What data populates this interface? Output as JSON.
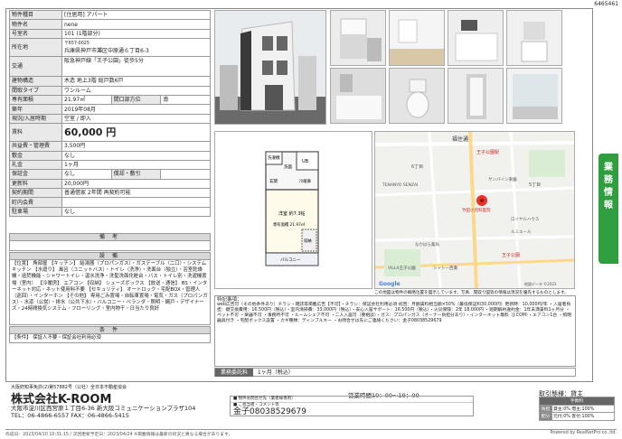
{
  "page_id": "6465461",
  "property": {
    "type_label": "物件種目",
    "type_value": "[住居用] アパート",
    "name_label": "物件名",
    "name_value": "nene",
    "room_label": "号室名",
    "room_value": "101 (1階部分)",
    "address_label": "所在地",
    "postcode": "〒657-0025",
    "address_value": "兵庫県神戸市灘区中原通６丁目6-3",
    "traffic_label": "交通",
    "traffic_value": "阪急神戸線「王子公園」徒歩5分",
    "structure_label": "建物構造",
    "structure_value": "木造 地上3階 総戸数6戸",
    "layout_label": "間取タイプ",
    "layout_value": "ワンルーム",
    "area_label": "専有面積",
    "area_value": "21.97㎡",
    "direction_label": "間口部方位",
    "direction_value": "南",
    "built_label": "築年",
    "built_value": "2019年08月",
    "status_label": "現況/入居時期",
    "status_value": "空室 / 即入",
    "rent_label": "賃料",
    "rent_value": "60,000 円",
    "common_label": "共益費・管理費",
    "common_value": "3,500円",
    "deposit_label": "敷金",
    "deposit_value": "なし",
    "key_label": "礼金",
    "key_value": "1ヶ月",
    "guarantee_label": "保証金",
    "guarantee_value": "なし",
    "amort_label": "償却・敷引",
    "amort_value": "",
    "renew_label": "更新料",
    "renew_value": "20,000円",
    "contract_label": "契約期間",
    "contract_value": "普通借家 2年間 再契約可能",
    "inside_label": "町内会費",
    "inside_value": "",
    "parking_label": "駐車場",
    "parking_value": "なし"
  },
  "remarks": {
    "title": "備 考",
    "body": ""
  },
  "facilities": {
    "title": "設 備",
    "body": "【位置】 角部屋 【キッチン】 給湯器（プロパンガス）・ガステーブル（二口）・システムキッチン 【水廻り】 風呂（ユニットバス）・トイレ（洗浄）・洗面台（独立）・浴室乾燥機・追焚機能・シャワートイレ・温水洗浄・洗髪洗面化粧台・バス・トイレ別・洗濯機置場（室内） 【冷暖房】 エアコン 【収納】 シューズボックス 【放送・通信】 BS・インターネット対応・ネット使用料不要 【セキュリティ】 オートロック・宅配BOX・管理人（巡回）・インターホン 【その他】 専用ごみ置場・自転車置場・電気・ガス（プロパンガス）・水道（公営）・排水（公共下水）・バルコニー・ベランダ・照明・網戸・デザイナーズ・24時間換気システム・フローリング・室内物干・日当たり良好"
  },
  "conditions": {
    "title": "条 件",
    "body": "【条件】 保証人不要・保証会社利用必須"
  },
  "floor_plan": {
    "labels": [
      "洗濯機",
      "UB",
      "洗面",
      "玄関",
      "洋室",
      "バルコニー",
      "冷蔵庫",
      "収納"
    ],
    "room_text": "洋室 約7.3帖",
    "area_text": "専有面積 21.97㎡"
  },
  "map": {
    "labels": [
      "福住通",
      "王子公園駅",
      "6丁目",
      "5丁目",
      "TENANYO SENZAI",
      "サンパイン楽園",
      "竹田小児科医院",
      "王子公園",
      "なかはら薬局",
      "VILLA王子公園",
      "ロイヤルハウス",
      "シャトー西灘",
      "ルミエール",
      "Google"
    ],
    "copyright": "地図データ ©2023",
    "note": "この地図は物件の概略位置を図示しています。写真、間取り図等の情報は現況を優先するものとします。"
  },
  "notes": {
    "title": "特記事項：",
    "body": "web広告可（その他条件あり）チラシ・雑誌等掲載広告【不可】・チラシ：保証会社利用必須 初回：月額賃料相当額×50%（最低保証料30,000円）更新時：10,000円/年 ・入居者負担：鍵交換費用：16,500円（税込）・室内清掃費：33,000円（税込）・安心入居サポート：16,500円（税込）・火災保険：2年 18,000円 ・短期解約違約金：1年未満賃料1ヶ月分 ・ペット不可 ・楽器不可 ・事務所不可 ・ルームシェア不可 ・二人入居可（要相談）・ガス：プロパンガス（オーナー負担分あり）・インターネット無料（J:COM）・エアコン1台 ・照明器具付き ・宅配ボックス設置 ・カギ種類：ディンプルキー ・お問合せは先にご連絡ください：金子08038529679"
  },
  "commission": {
    "label": "業務委託料",
    "value": "1ヶ月（税込）"
  },
  "side_tab": [
    "業",
    "務",
    "情",
    "報"
  ],
  "company": {
    "license": "大阪府知事免許(2)第57882号（公社）全日本不動産協会",
    "name": "株式会社K-ROOM",
    "address": "大阪市淀川区西宮原１丁目6-36 新大阪コミュニケーションプラザ104",
    "phone": "TEL：06-4866-6557  FAX：06-4866-5415",
    "hours": "営業時間10：00～19：00"
  },
  "contact": {
    "line1": "■ 物件お問合せ先（業者様専用）",
    "line2": "■ ご担当者・コメント等",
    "name": "金子08038529679"
  },
  "fees": {
    "title": "取引態様：貸主",
    "head": "手数料",
    "rows": [
      {
        "k": "負担",
        "v": "貸主:0% 借主:100%"
      },
      {
        "k": "配分",
        "v": "元付:0% 客付:100%"
      }
    ]
  },
  "footer": {
    "left": "作成日：2023/04/10 10:31:15 / 次回更新予定日：2023/04/24 ※掲載情報は最新の状況と異なる場合があります。",
    "right": "Powered by RealNetPro co.,ltd."
  }
}
